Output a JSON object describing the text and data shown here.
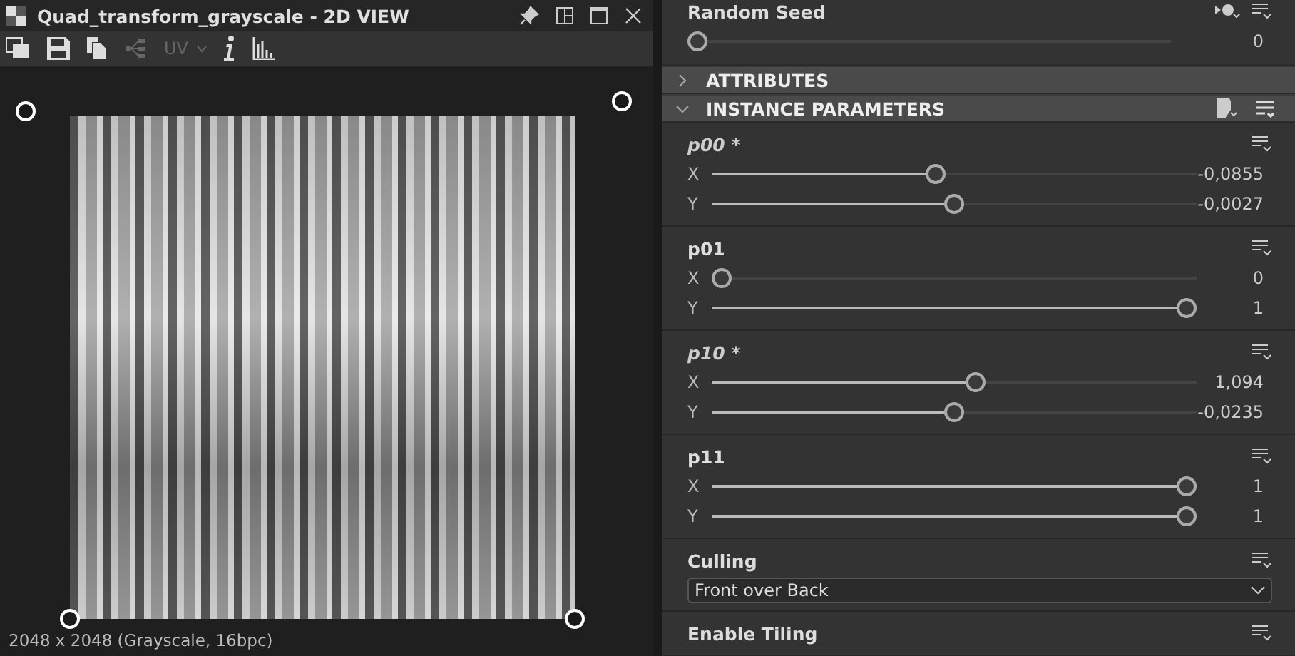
{
  "view": {
    "title": "Quad_transform_grayscale - 2D VIEW",
    "status": "2048 x 2048 (Grayscale, 16bpc)"
  },
  "toolbar": [
    {
      "kind": "display",
      "disabled": false
    },
    {
      "kind": "save",
      "disabled": false
    },
    {
      "kind": "copy",
      "disabled": false
    },
    {
      "kind": "graph",
      "disabled": true
    },
    {
      "kind": "uv",
      "label": "UV",
      "disabled": true
    },
    {
      "kind": "info",
      "disabled": false
    },
    {
      "kind": "histogram",
      "disabled": false
    }
  ],
  "random_seed": {
    "label": "Random Seed",
    "level": 0,
    "value": "0"
  },
  "sections": [
    {
      "title": "ATTRIBUTES",
      "expanded": false
    },
    {
      "title": "INSTANCE PARAMETERS",
      "expanded": true
    }
  ],
  "params": [
    {
      "name": "p00 *",
      "modified": true,
      "axes": [
        {
          "label": "X",
          "level": 0.46,
          "value": "-0,0855"
        },
        {
          "label": "Y",
          "level": 0.5,
          "value": "-0,0027"
        }
      ]
    },
    {
      "name": "p01",
      "modified": false,
      "axes": [
        {
          "label": "X",
          "level": 0,
          "value": "0"
        },
        {
          "label": "Y",
          "level": 1,
          "value": "1"
        }
      ]
    },
    {
      "name": "p10 *",
      "modified": true,
      "axes": [
        {
          "label": "X",
          "level": 0.545,
          "value": "1,094"
        },
        {
          "label": "Y",
          "level": 0.5,
          "value": "-0,0235"
        }
      ]
    },
    {
      "name": "p11",
      "modified": false,
      "axes": [
        {
          "label": "X",
          "level": 1,
          "value": "1"
        },
        {
          "label": "Y",
          "level": 1,
          "value": "1"
        }
      ]
    }
  ],
  "culling": {
    "label": "Culling",
    "value": "Front over Back"
  },
  "enable_tiling": {
    "label": "Enable Tiling"
  }
}
